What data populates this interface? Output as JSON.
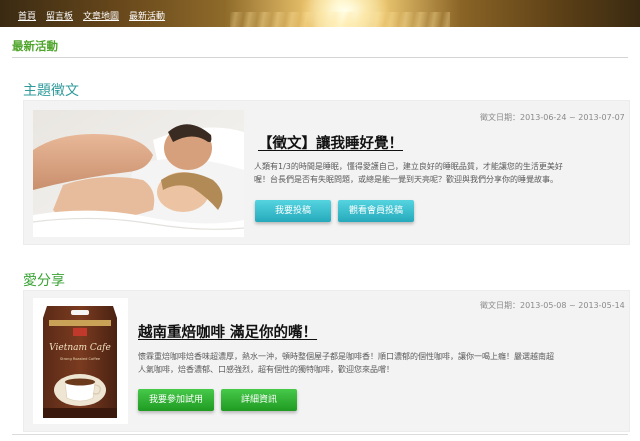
{
  "nav": {
    "items": [
      "首頁",
      "留言板",
      "文章地圖",
      "最新活動"
    ]
  },
  "page": {
    "title": "最新活動"
  },
  "section1": {
    "heading": "主題徵文",
    "date": "徵文日期：2013-06-24 ~ 2013-07-07",
    "title": "【徵文】讓我睡好覺！",
    "desc_line1": "人類有1/3的時間是睡眠，懂得愛護自己，建立良好的睡眠品質，才能讓您的生活更美好",
    "desc_line2": "喔！台長們是否有失眠問題，或總是能一覺到天亮呢？歡迎與我們分享你的睡覺故事。",
    "btn_submit": "我要投稿",
    "btn_view": "觀看會員投稿"
  },
  "section2": {
    "heading": "愛分享",
    "date": "徵文日期：2013-05-08 ~ 2013-05-14",
    "title": "越南重焙咖啡 滿足你的嘴！",
    "desc_line1": "懷霖重焙咖啡焙香味超濃厚，熱水一沖，頓時整個屋子都是咖啡香！順口濃郁的個性咖啡，讓你一喝上癮！嚴選越南超",
    "desc_line2": "人氣咖啡，焙香濃郁、口感強烈，超有個性的獨特咖啡，歡迎您來品嚐！",
    "btn_join": "我要參加試用",
    "btn_detail": "詳細資訊",
    "product_brand": "Vietnam Cafe",
    "product_sub": "Strong Roasted Coffee"
  },
  "colors": {
    "accent_green": "#4fa52a",
    "heading_teal": "#2f9a9b",
    "button_teal": "#25a9bb",
    "button_green": "#1f9a22"
  }
}
